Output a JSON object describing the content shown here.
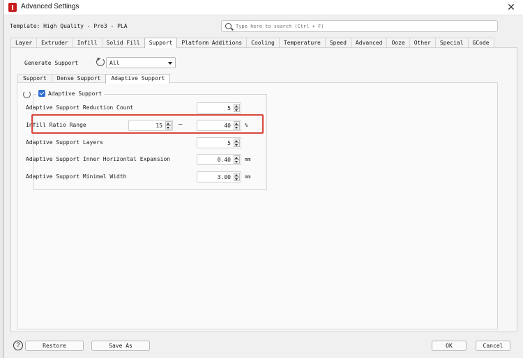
{
  "window": {
    "title": "Advanced Settings",
    "close_glyph": "✕"
  },
  "template": {
    "label": "Template: High Quality - Pro3 - PLA"
  },
  "search": {
    "placeholder": "Type here to search (Ctrl + F)"
  },
  "main_tabs": [
    {
      "label": "Layer"
    },
    {
      "label": "Extruder"
    },
    {
      "label": "Infill"
    },
    {
      "label": "Solid Fill"
    },
    {
      "label": "Support",
      "active": true
    },
    {
      "label": "Platform Additions"
    },
    {
      "label": "Cooling"
    },
    {
      "label": "Temperature"
    },
    {
      "label": "Speed"
    },
    {
      "label": "Advanced"
    },
    {
      "label": "Ooze"
    },
    {
      "label": "Other"
    },
    {
      "label": "Special"
    },
    {
      "label": "GCode"
    }
  ],
  "generate_support": {
    "label": "Generate Support",
    "value": "All"
  },
  "sub_tabs": [
    {
      "label": "Support"
    },
    {
      "label": "Dense Support"
    },
    {
      "label": "Adaptive Support",
      "active": true
    }
  ],
  "adaptive": {
    "checkbox_label": "Adaptive Support",
    "checked": true,
    "rows": {
      "reduction_count": {
        "label": "Adaptive Support Reduction Count",
        "value": "5"
      },
      "infill_ratio": {
        "label": "Infill Ratio Range",
        "min": "15",
        "separator": "—",
        "max": "40",
        "unit": "%"
      },
      "layers": {
        "label": "Adaptive Support Layers",
        "value": "5"
      },
      "inner_expansion": {
        "label": "Adaptive Support Inner Horizontal Expansion",
        "value": "0.40",
        "unit": "mm"
      },
      "minimal_width": {
        "label": "Adaptive Support Minimal Width",
        "value": "3.00",
        "unit": "mm"
      }
    }
  },
  "footer": {
    "help_glyph": "?",
    "restore_label": "Restore",
    "save_as_label": "Save As",
    "ok_label": "OK",
    "cancel_label": "Cancel"
  },
  "colors": {
    "highlight": "#d9463a",
    "checkbox": "#2f6fd6",
    "app_icon": "#c61d1d"
  }
}
